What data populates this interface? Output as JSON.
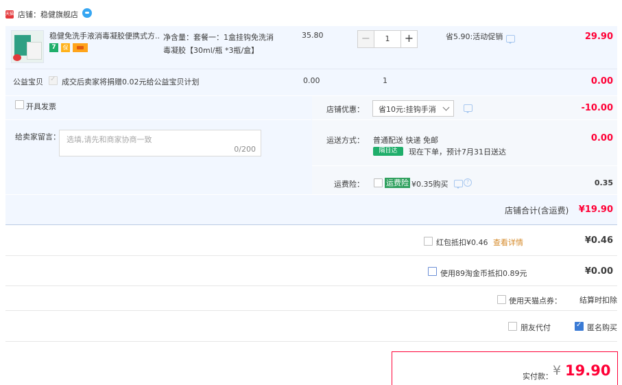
{
  "shop": {
    "label": "店铺：稳健旗舰店",
    "tmall_icon": "天猫"
  },
  "item": {
    "title": "稳健免洗手液消毒凝胶便携式方...",
    "badge_7": "7",
    "badge_shield": "保",
    "spec_line1": "净含量：套餐一：1盒挂钩免洗消",
    "spec_line2": "毒凝胶【30ml/瓶 *3瓶/盒】",
    "unit_price": "35.80",
    "quantity": "1",
    "minus": "−",
    "plus": "+",
    "promo": "省5.90:活动促销",
    "subtotal": "29.90"
  },
  "charity": {
    "label": "公益宝贝",
    "text": "成交后卖家将捐赠0.02元给公益宝贝计划",
    "price": "0.00",
    "qty": "1",
    "total": "0.00"
  },
  "invoice": {
    "label": "开具发票"
  },
  "message": {
    "label": "给卖家留言：",
    "placeholder": "选填,请先和商家协商一致",
    "counter": "0/200"
  },
  "coupon": {
    "label": "店铺优惠：",
    "selected": "省10元:挂钩手消",
    "amount": "-10.00"
  },
  "shipping": {
    "label": "运送方式：",
    "method": "普通配送 快递 免邮",
    "badge": "隔日达",
    "eta": "现在下单，预计7月31日送达",
    "amount": "0.00"
  },
  "insurance": {
    "label": "运费险：",
    "badge": "运费险",
    "text": "¥0.35购买",
    "q": "?",
    "amount": "0.35"
  },
  "shop_total": {
    "label": "店铺合计(含运费)",
    "amount": "¥19.90"
  },
  "redpacket": {
    "label": "红包抵扣¥0.46",
    "link": "查看详情",
    "amount": "¥0.46"
  },
  "taojinbi": {
    "label": "使用89淘金币抵扣0.89元",
    "amount": "¥0.00"
  },
  "tmall_points": {
    "label": "使用天猫点券：",
    "value": "结算时扣除"
  },
  "friend_pay": {
    "label": "朋友代付"
  },
  "anonymous": {
    "label": "匿名购买"
  },
  "payment": {
    "label": "实付款：",
    "currency": "¥",
    "amount": "19.90"
  },
  "colors": {
    "accent_red": "#ff0036",
    "light_blue_bg": "#f2f7ff",
    "badge_green": "#1fae6b"
  }
}
